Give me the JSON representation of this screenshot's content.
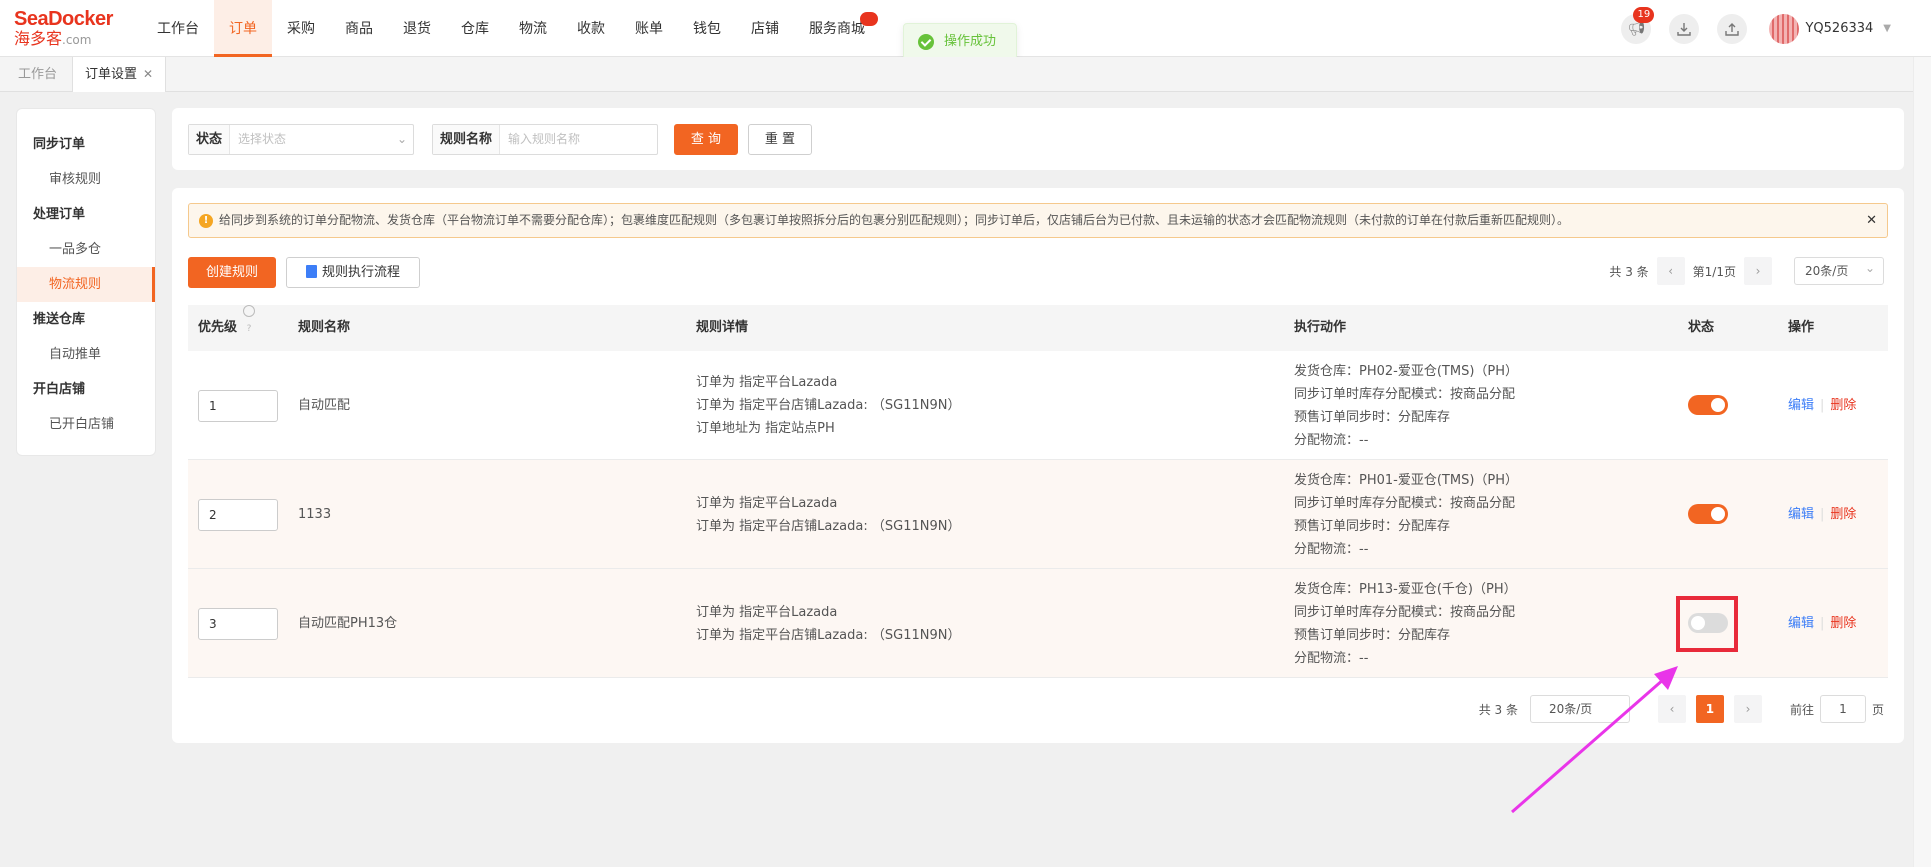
{
  "logo": {
    "brand": "SeaDocker",
    "cn": "海多客",
    "suffix": ".com"
  },
  "nav": {
    "items": [
      {
        "label": "工作台"
      },
      {
        "label": "订单"
      },
      {
        "label": "采购"
      },
      {
        "label": "商品"
      },
      {
        "label": "退货"
      },
      {
        "label": "仓库"
      },
      {
        "label": "物流"
      },
      {
        "label": "收款"
      },
      {
        "label": "账单"
      },
      {
        "label": "钱包"
      },
      {
        "label": "店铺"
      },
      {
        "label": "服务商城"
      }
    ],
    "active_index": 1
  },
  "toast": {
    "message": "操作成功"
  },
  "header_right": {
    "notify_count": "19",
    "username": "YQ526334"
  },
  "tabs": [
    {
      "label": "工作台"
    },
    {
      "label": "订单设置"
    }
  ],
  "sidebar": {
    "groups": [
      {
        "title": "同步订单",
        "items": [
          "审核规则"
        ]
      },
      {
        "title": "处理订单",
        "items": [
          "一品多仓",
          "物流规则"
        ]
      },
      {
        "title": "推送仓库",
        "items": [
          "自动推单"
        ]
      },
      {
        "title": "开白店铺",
        "items": [
          "已开白店铺"
        ]
      }
    ],
    "active_item": "物流规则"
  },
  "search": {
    "status_label": "状态",
    "status_placeholder": "选择状态",
    "name_label": "规则名称",
    "name_placeholder": "输入规则名称",
    "query_button": "查 询",
    "reset_button": "重 置"
  },
  "alert": {
    "text": "给同步到系统的订单分配物流、发货仓库（平台物流订单不需要分配仓库）；包裹维度匹配规则（多包裹订单按照拆分后的包裹分别匹配规则）；同步订单后，仅店铺后台为已付款、且未运输的状态才会匹配物流规则（未付款的订单在付款后重新匹配规则）。"
  },
  "actions": {
    "create": "创建规则",
    "flow": "规则执行流程"
  },
  "pager_top": {
    "total": "共 3 条",
    "page": "第1/1页",
    "size": "20条/页"
  },
  "table": {
    "headers": {
      "priority": "优先级",
      "name": "规则名称",
      "detail": "规则详情",
      "action": "执行动作",
      "status": "状态",
      "ops": "操作"
    },
    "rows": [
      {
        "priority": "1",
        "name": "自动匹配",
        "details": [
          "订单为 指定平台Lazada",
          "订单为 指定平台店铺Lazada: （SG11N9N）",
          "订单地址为 指定站点PH"
        ],
        "actions": [
          "发货仓库：PH02-爱亚仓(TMS)（PH）",
          "同步订单时库存分配模式：按商品分配",
          "预售订单同步时：分配库存",
          "分配物流：--"
        ],
        "enabled": true
      },
      {
        "priority": "2",
        "name": "1133",
        "details": [
          "订单为 指定平台Lazada",
          "订单为 指定平台店铺Lazada: （SG11N9N）"
        ],
        "actions": [
          "发货仓库：PH01-爱亚仓(TMS)（PH）",
          "同步订单时库存分配模式：按商品分配",
          "预售订单同步时：分配库存",
          "分配物流：--"
        ],
        "enabled": true
      },
      {
        "priority": "3",
        "name": "自动匹配PH13仓",
        "details": [
          "订单为 指定平台Lazada",
          "订单为 指定平台店铺Lazada: （SG11N9N）"
        ],
        "actions": [
          "发货仓库：PH13-爱亚仓(千仓)（PH）",
          "同步订单时库存分配模式：按商品分配",
          "预售订单同步时：分配库存",
          "分配物流：--"
        ],
        "enabled": false
      }
    ],
    "edit_label": "编辑",
    "delete_label": "删除"
  },
  "pager_bottom": {
    "total": "共 3 条",
    "size": "20条/页",
    "current": "1",
    "goto_label": "前往",
    "goto_value": "1",
    "page_unit": "页"
  },
  "colors": {
    "accent": "#f26522",
    "link": "#3d7ef7",
    "danger": "#e8341e",
    "highlight": "#e82a3a",
    "annotation_arrow": "#e935e9"
  }
}
